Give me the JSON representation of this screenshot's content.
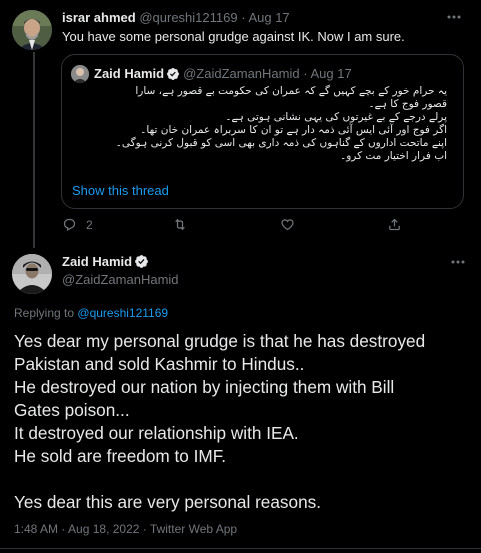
{
  "parent_tweet": {
    "author_name": "israr ahmed",
    "handle": "@qureshi121169",
    "separator": "·",
    "date": "Aug 17",
    "text": "You have some personal grudge against IK. Now I am sure.",
    "more_icon": "ellipsis-icon",
    "quoted_tweet": {
      "author_name": "Zaid Hamid",
      "handle": "@ZaidZamanHamid",
      "separator": "·",
      "date": "Aug 17",
      "lines": [
        "یہ حرام خور کے بچے کہیں گے کہ عمران کی حکومت بے قصور ہے، سارا",
        "قصور فوج کا ہے۔",
        "پرلے درجے کے بے غیرتوں کی یہی نشانی ہوتی ہے۔",
        "اگر فوج اور آئی ایس آئی ذمہ دار ہے تو ان کا سربراہ عمران خان تھا۔",
        "اپنے ماتحت اداروں کے گناہوں کی ذمہ داری بھی اسی کو قبول کرنی ہوگی۔",
        "اب فرار اختیار مت کرو۔"
      ],
      "show_thread_label": "Show this thread"
    },
    "actions": {
      "reply_count": "2",
      "retweet_count": "",
      "like_count": "",
      "share_count": ""
    }
  },
  "main_tweet": {
    "author_name": "Zaid Hamid",
    "handle": "@ZaidZamanHamid",
    "verified": true,
    "more_icon": "ellipsis-icon",
    "replying_prefix": "Replying to",
    "replying_handle": "@qureshi121169",
    "body_lines": [
      "Yes dear my personal grudge is that he has destroyed",
      "Pakistan and sold Kashmir to Hindus..",
      "He destroyed our nation by injecting them with Bill",
      "Gates poison...",
      "It destroyed our relationship with IEA.",
      "He sold are freedom to IMF.",
      "",
      "Yes dear this are very personal reasons."
    ],
    "time": "1:48 AM",
    "separator": "·",
    "date": "Aug 18, 2022",
    "source": "Twitter Web App"
  },
  "colors": {
    "background": "#000000",
    "text": "#e7e9ea",
    "secondary": "#71767b",
    "link": "#1d9bf0",
    "border": "#2f3336"
  }
}
